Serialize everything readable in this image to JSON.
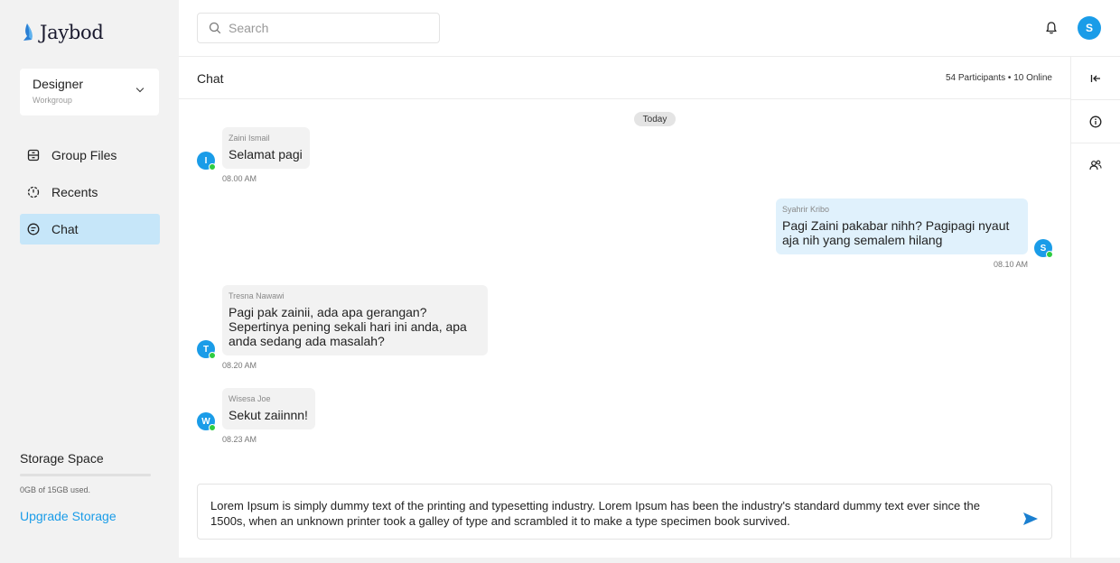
{
  "app": {
    "name": "Jaybod"
  },
  "workgroup": {
    "name": "Designer",
    "sub": "Workgroup"
  },
  "nav": [
    {
      "label": "Group Files",
      "icon": "file-box-icon",
      "active": false
    },
    {
      "label": "Recents",
      "icon": "clock-icon",
      "active": false
    },
    {
      "label": "Chat",
      "icon": "chat-icon",
      "active": true
    }
  ],
  "storage": {
    "title": "Storage Space",
    "used_text": "0GB of 15GB used.",
    "used_fraction": 0,
    "upgrade_label": "Upgrade Storage"
  },
  "search": {
    "placeholder": "Search"
  },
  "user": {
    "initial": "S"
  },
  "chat": {
    "title": "Chat",
    "participants": "54 Participants • 10 Online",
    "day_label": "Today",
    "messages": [
      {
        "sender": "Zaini Ismail",
        "initial": "I",
        "text": "Selamat pagi",
        "time": "08.00 AM",
        "own": false
      },
      {
        "sender": "Syahrir Kribo",
        "initial": "S",
        "text": "Pagi Zaini pakabar nihh? Pagipagi nyaut aja nih yang semalem hilang",
        "time": "08.10 AM",
        "own": true
      },
      {
        "sender": "Tresna Nawawi",
        "initial": "T",
        "text": "Pagi pak zainii, ada apa gerangan? Sepertinya pening sekali hari ini anda, apa anda sedang ada masalah?",
        "time": "08.20 AM",
        "own": false
      },
      {
        "sender": "Wisesa Joe",
        "initial": "W",
        "text": "Sekut zaiinnn!",
        "time": "08.23 AM",
        "own": false
      }
    ],
    "composer_text": "Lorem Ipsum is simply dummy text of the printing and typesetting industry. Lorem Ipsum has been the industry's standard dummy text ever since the 1500s, when an unknown printer took a galley of type and scrambled it to make a type specimen book survived."
  },
  "colors": {
    "accent": "#1a9ce8",
    "active_nav": "#c6e6f9",
    "online": "#2ecc40"
  }
}
